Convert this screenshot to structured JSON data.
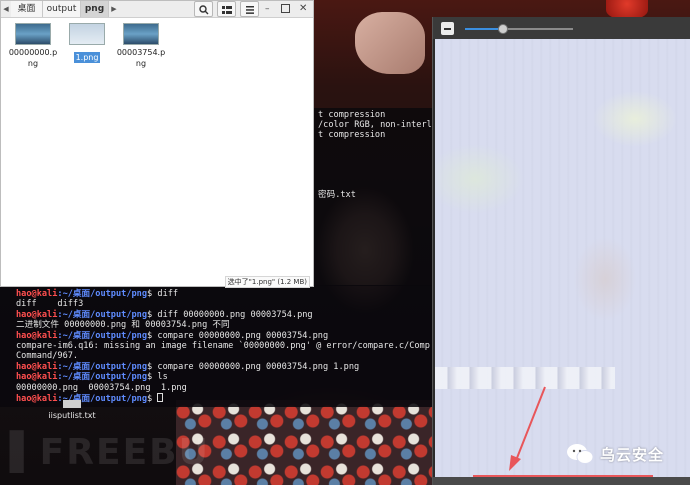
{
  "file_manager": {
    "breadcrumbs": [
      "桌面",
      "output",
      "png"
    ],
    "active_breadcrumb": "png",
    "files": [
      {
        "name": "00000000.png",
        "selected": false
      },
      {
        "name": "1.png",
        "selected": true
      },
      {
        "name": "00003754.png",
        "selected": false
      }
    ],
    "status": "选中了\"1.png\" (1.2 MB)",
    "toolbar_icons": [
      "search-icon",
      "grid-view-icon",
      "menu-icon"
    ]
  },
  "terminal_upper": [
    "t compression",
    "/color RGB, non-interl",
    "t compression",
    "",
    "",
    "",
    "",
    "",
    "密码.txt"
  ],
  "terminal": {
    "prompt_user": "hao@kali",
    "prompt_path": ":~/桌面/output/png",
    "prompt_sign": "$ ",
    "lines": [
      {
        "type": "prompt",
        "cmd": "diff"
      },
      {
        "type": "out",
        "text": "diff    diff3"
      },
      {
        "type": "prompt",
        "cmd": "diff 00000000.png 00003754.png"
      },
      {
        "type": "out",
        "text": "二进制文件 00000000.png 和 00003754.png 不同"
      },
      {
        "type": "prompt",
        "cmd": "compare 00000000.png 00003754.png"
      },
      {
        "type": "out",
        "text": "compare-im6.q16: missing an image filename `00000000.png' @ error/compare.c/Comp"
      },
      {
        "type": "out",
        "text": "Command/967."
      },
      {
        "type": "prompt",
        "cmd": "compare 00000000.png 00003754.png 1.png"
      },
      {
        "type": "prompt",
        "cmd": "ls"
      },
      {
        "type": "out",
        "text": "00000000.png  00003754.png  1.png"
      },
      {
        "type": "prompt",
        "cmd": "",
        "cursor": true
      }
    ]
  },
  "desktop_icon": {
    "label": "iisputlist.txt"
  },
  "viewer": {
    "zoom_level": 0.35
  },
  "brand": {
    "text": "乌云安全"
  },
  "colors": {
    "prompt_user": "#ff4f4f",
    "prompt_path": "#5f8cff",
    "selection": "#4a90d9",
    "arrow": "#e8565a"
  }
}
